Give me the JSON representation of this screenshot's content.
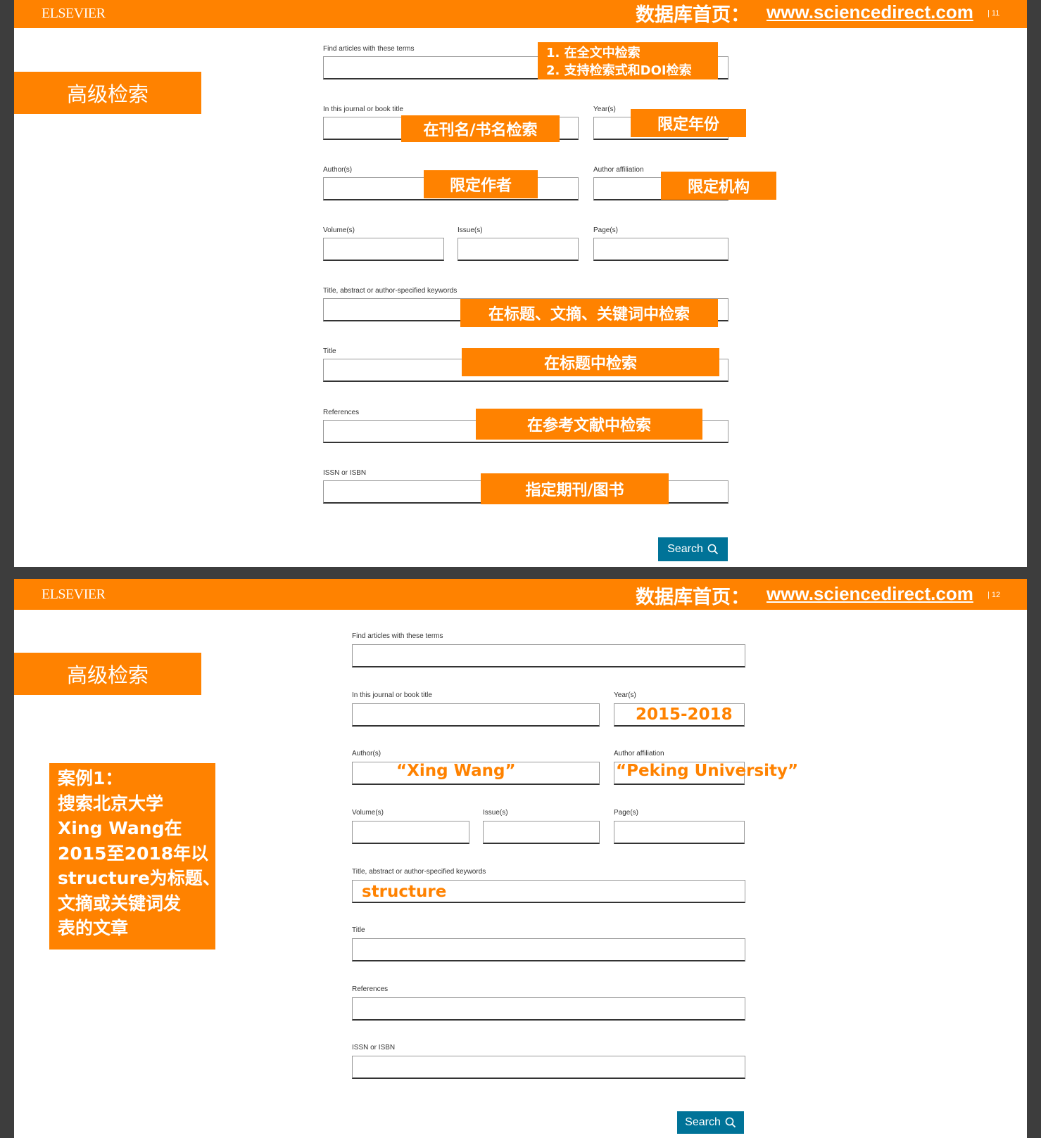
{
  "slides": [
    {
      "header": {
        "logo": "ELSEVIER",
        "db_label": "数据库首页：",
        "db_url": "www.sciencedirect.com",
        "page_number": "| 11"
      },
      "section_title": "高级检索",
      "fields": {
        "terms": "Find articles with these terms",
        "journal": "In this journal or book title",
        "year": "Year(s)",
        "authors": "Author(s)",
        "affiliation": "Author affiliation",
        "volume": "Volume(s)",
        "issue": "Issue(s)",
        "pages": "Page(s)",
        "keywords": "Title, abstract or author-specified keywords",
        "title": "Title",
        "references": "References",
        "issn": "ISSN or ISBN"
      },
      "callouts": {
        "terms_1": "1.  在全文中检索",
        "terms_2": "2. 支持检索式和DOI检索",
        "journal": "在刊名/书名检索",
        "year": "限定年份",
        "author": "限定作者",
        "affiliation": "限定机构",
        "keywords": "在标题、文摘、关键词中检索",
        "title": "在标题中检索",
        "references": "在参考文献中检索",
        "issn": "指定期刊/图书"
      },
      "search_button": "Search"
    },
    {
      "header": {
        "logo": "ELSEVIER",
        "db_label": "数据库首页：",
        "db_url": "www.sciencedirect.com",
        "page_number": "| 12"
      },
      "section_title": "高级检索",
      "case_text": [
        "案例1：",
        "搜索北京大学",
        "Xing Wang在",
        "2015至2018年以",
        "structure为标题、",
        "文摘或关键词发",
        "表的文章"
      ],
      "fields": {
        "terms": "Find articles with these terms",
        "journal": "In this journal or book title",
        "year": "Year(s)",
        "authors": "Author(s)",
        "affiliation": "Author affiliation",
        "volume": "Volume(s)",
        "issue": "Issue(s)",
        "pages": "Page(s)",
        "keywords": "Title, abstract or author-specified keywords",
        "title": "Title",
        "references": "References",
        "issn": "ISSN or ISBN"
      },
      "filled": {
        "year": "2015-2018",
        "author": "“Xing Wang”",
        "affiliation": "“Peking University”",
        "keywords": "structure"
      },
      "search_button": "Search"
    }
  ],
  "colors": {
    "accent": "#ff8200",
    "button": "#007398",
    "background": "#3d3d3d"
  },
  "icons": [
    "search-icon"
  ]
}
